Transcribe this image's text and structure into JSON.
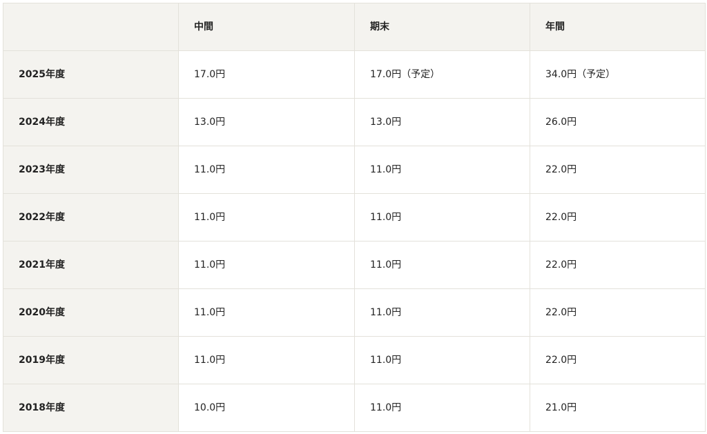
{
  "table": {
    "headers": [
      "",
      "中間",
      "期末",
      "年間"
    ],
    "rows": [
      {
        "year": "2025年度",
        "interim": "17.0円",
        "year_end": "17.0円（予定）",
        "annual": "34.0円（予定）"
      },
      {
        "year": "2024年度",
        "interim": "13.0円",
        "year_end": "13.0円",
        "annual": "26.0円"
      },
      {
        "year": "2023年度",
        "interim": "11.0円",
        "year_end": "11.0円",
        "annual": "22.0円"
      },
      {
        "year": "2022年度",
        "interim": "11.0円",
        "year_end": "11.0円",
        "annual": "22.0円"
      },
      {
        "year": "2021年度",
        "interim": "11.0円",
        "year_end": "11.0円",
        "annual": "22.0円"
      },
      {
        "year": "2020年度",
        "interim": "11.0円",
        "year_end": "11.0円",
        "annual": "22.0円"
      },
      {
        "year": "2019年度",
        "interim": "11.0円",
        "year_end": "11.0円",
        "annual": "22.0円"
      },
      {
        "year": "2018年度",
        "interim": "10.0円",
        "year_end": "11.0円",
        "annual": "21.0円"
      }
    ]
  },
  "colors": {
    "header_bg": "#f4f3ef",
    "cell_bg": "#ffffff",
    "border": "#e3e1da",
    "text": "#222222"
  }
}
